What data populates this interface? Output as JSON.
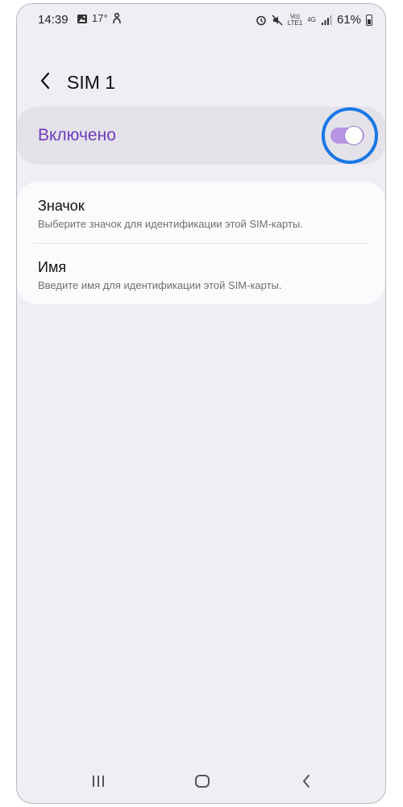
{
  "status_bar": {
    "time": "14:39",
    "temperature": "17°",
    "volte_top": "Vo)",
    "volte_bottom": "LTE1",
    "network": "4G",
    "battery": "61%",
    "icons": [
      "gallery-icon",
      "weather-icon",
      "person-icon",
      "alarm-icon",
      "mute-icon",
      "signal-icon",
      "battery-icon"
    ]
  },
  "header": {
    "title": "SIM 1"
  },
  "master_switch": {
    "label": "Включено",
    "enabled": true,
    "accent_color": "#6f3cbf",
    "toggle_color": "#b795e4",
    "highlight_color": "#1877e6"
  },
  "settings": [
    {
      "title": "Значок",
      "subtitle": "Выберите значок для идентификации этой SIM-карты."
    },
    {
      "title": "Имя",
      "subtitle": "Введите имя для идентификации этой SIM-карты."
    }
  ],
  "nav_bar": {
    "icons": [
      "recents-icon",
      "home-icon",
      "back-icon"
    ]
  }
}
